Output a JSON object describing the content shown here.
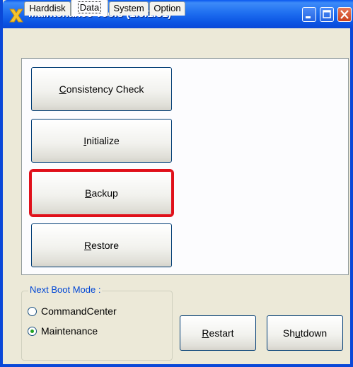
{
  "window": {
    "title": "Maintenance Tools (1.0.1.31)",
    "controls": {
      "minimize": "minimize-icon",
      "maximize": "maximize-icon",
      "close": "close-icon"
    }
  },
  "tabs": [
    {
      "label": "Harddisk",
      "active": false
    },
    {
      "label": "Data",
      "active": true
    },
    {
      "label": "System",
      "active": false
    },
    {
      "label": "Option",
      "active": false
    }
  ],
  "data_tab": {
    "buttons": [
      {
        "label": "Consistency Check",
        "mnemonic": "C",
        "rest": "onsistency Check",
        "highlighted": false
      },
      {
        "label": "Initialize",
        "mnemonic": "I",
        "rest": "nitialize",
        "highlighted": false
      },
      {
        "label": "Backup",
        "mnemonic": "B",
        "rest": "ackup",
        "highlighted": true
      },
      {
        "label": "Restore",
        "mnemonic": "R",
        "rest": "estore",
        "highlighted": false
      }
    ]
  },
  "boot_mode": {
    "legend": "Next Boot Mode :",
    "options": [
      {
        "label": "CommandCenter",
        "checked": false
      },
      {
        "label": "Maintenance",
        "checked": true
      }
    ]
  },
  "footer": {
    "restart": {
      "pre": "",
      "mnemonic": "R",
      "post": "estart"
    },
    "shutdown": {
      "pre": "Sh",
      "mnemonic": "u",
      "post": "tdown"
    }
  },
  "colors": {
    "titlebar": "#0a48d8",
    "highlight_border": "#e0101a",
    "window_bg": "#ece9d8"
  }
}
